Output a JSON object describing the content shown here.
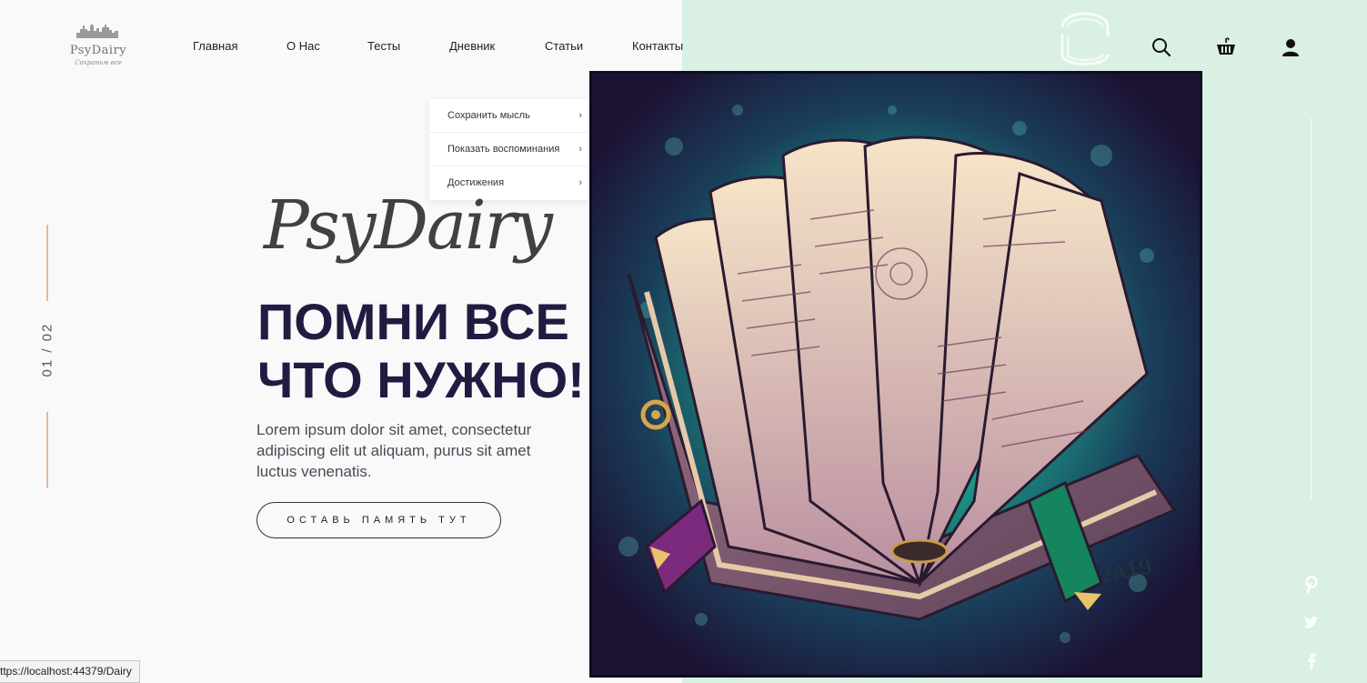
{
  "brand": {
    "logo_name": "PsyDairy",
    "logo_tagline": "Сохраним все"
  },
  "nav": {
    "items": [
      {
        "label": "Главная"
      },
      {
        "label": "О Нас"
      },
      {
        "label": "Тесты"
      },
      {
        "label": "Дневник"
      },
      {
        "label": "Статьи"
      },
      {
        "label": "Контакты"
      }
    ]
  },
  "header_icons": [
    "search-icon",
    "basket-icon",
    "user-icon"
  ],
  "dropdown": {
    "items": [
      {
        "label": "Сохранить мысль",
        "chevron": "›"
      },
      {
        "label": "Показать воспоминания",
        "chevron": "›"
      },
      {
        "label": "Достижения",
        "chevron": "›"
      }
    ]
  },
  "slider": {
    "counter": "01 / 02"
  },
  "hero": {
    "script_title": "PsyDairy",
    "headline_line1": "ПОМНИ ВСЕ",
    "headline_line2": "ЧТО НУЖНО!",
    "lead": "Lorem ipsum dolor sit amet, consectetur adipiscing elit ut aliquam, purus sit amet luctus venenatis.",
    "cta_label": "ОСТАВЬ ПАМЯТЬ ТУТ"
  },
  "artwork": {
    "signature": "2A19"
  },
  "social_icons": [
    "pinterest-icon",
    "twitter-icon",
    "facebook-icon"
  ],
  "status_bar": {
    "url": "ttps://localhost:44379/Dairy"
  },
  "colors": {
    "right_panel": "#d9f0e3",
    "headline": "#221b41",
    "accent_line": "#e8b5a0"
  }
}
